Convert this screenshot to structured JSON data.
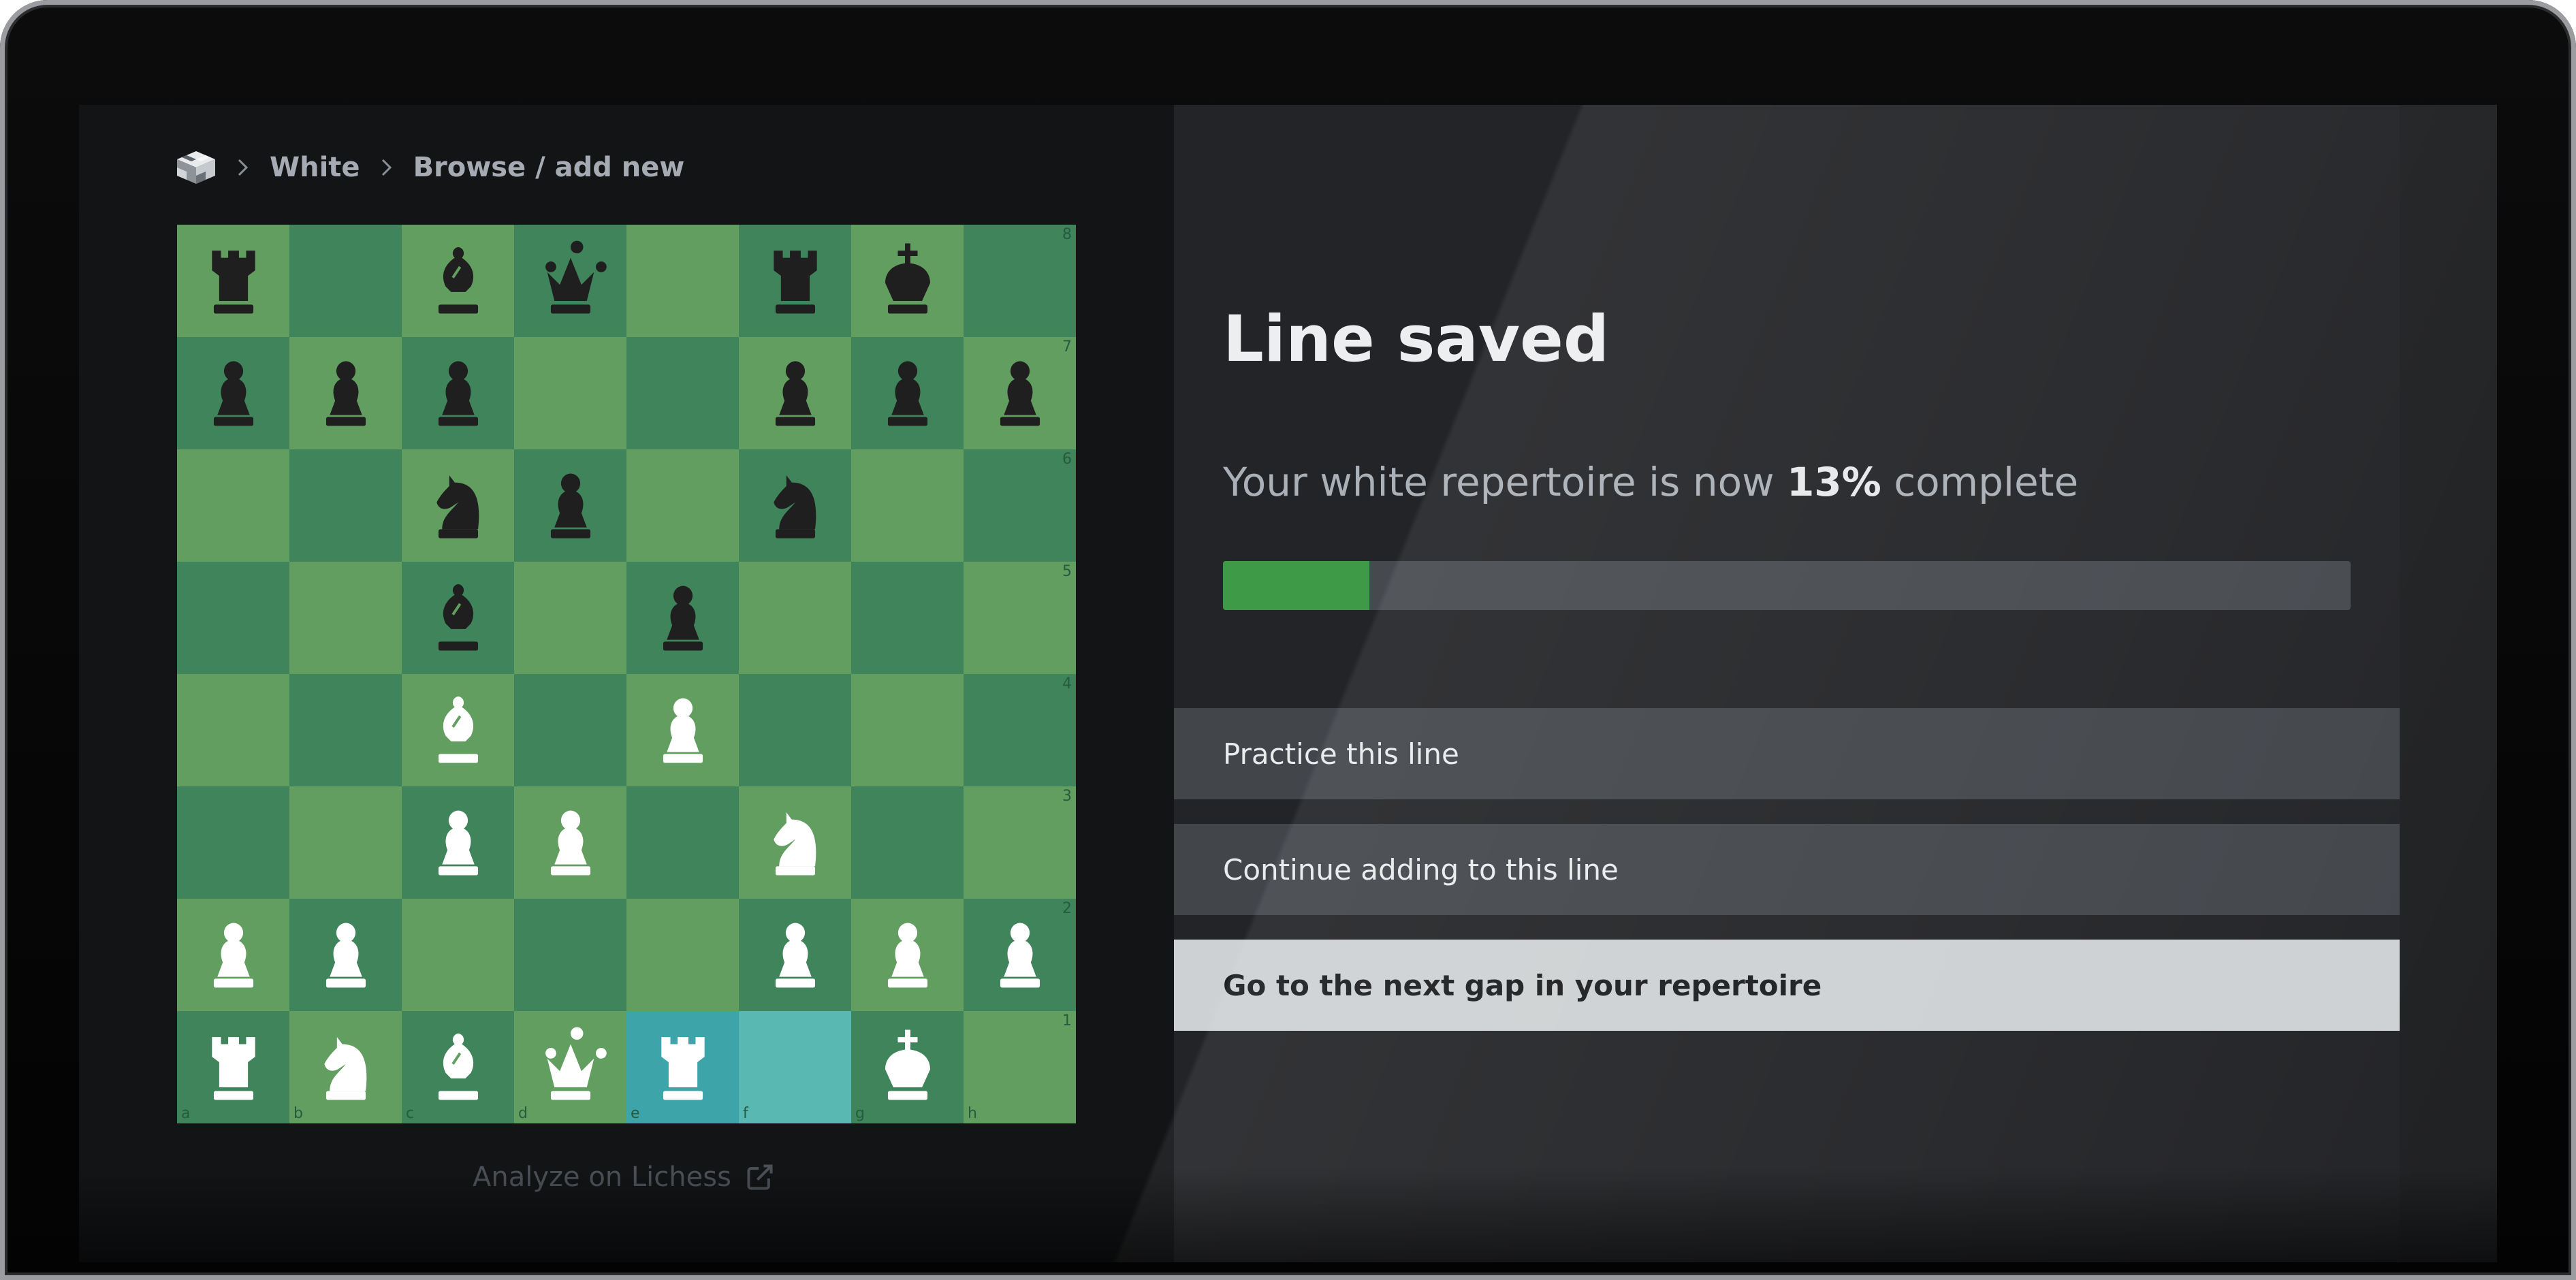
{
  "breadcrumb": {
    "logo_icon": "checkered-cube-logo",
    "items": [
      "White",
      "Browse / add new"
    ]
  },
  "board": {
    "rank_labels": [
      "8",
      "7",
      "6",
      "5",
      "4",
      "3",
      "2",
      "1"
    ],
    "file_labels": [
      "a",
      "b",
      "c",
      "d",
      "e",
      "f",
      "g",
      "h"
    ],
    "light_square_color": "#629e5f",
    "dark_square_color": "#3f845a",
    "last_move_highlight_colors": [
      "#3da4aa",
      "#5ab8b3"
    ],
    "ranks": [
      [
        "br",
        "",
        "bb",
        "bq",
        "",
        "br",
        "bk",
        ""
      ],
      [
        "bp",
        "bp",
        "bp",
        "",
        "",
        "bp",
        "bp",
        "bp"
      ],
      [
        "",
        "",
        "bn",
        "bp",
        "",
        "bn",
        "",
        ""
      ],
      [
        "",
        "",
        "bb",
        "",
        "bp",
        "",
        "",
        ""
      ],
      [
        "",
        "",
        "wb",
        "",
        "wp",
        "",
        "",
        ""
      ],
      [
        "",
        "",
        "wp",
        "wp",
        "",
        "wn",
        "",
        ""
      ],
      [
        "wp",
        "wp",
        "",
        "",
        "",
        "wp",
        "wp",
        "wp"
      ],
      [
        "wr",
        "wn",
        "wb",
        "wq",
        "wr",
        "",
        "wk",
        ""
      ]
    ],
    "highlighted_squares": [
      "e1",
      "f1"
    ]
  },
  "analyze": {
    "label": "Analyze on Lichess",
    "icon": "external-link-icon"
  },
  "panel": {
    "title": "Line saved",
    "subtitle_prefix": "Your white repertoire is now",
    "subtitle_value": "13%",
    "subtitle_suffix": "complete",
    "progress_fraction": 0.13,
    "progress_color": "#3f9a47",
    "actions": [
      {
        "label": "Practice this line",
        "style": "secondary"
      },
      {
        "label": "Continue adding to this line",
        "style": "secondary"
      },
      {
        "label": "Go to the next gap in your repertoire",
        "style": "primary"
      }
    ]
  }
}
